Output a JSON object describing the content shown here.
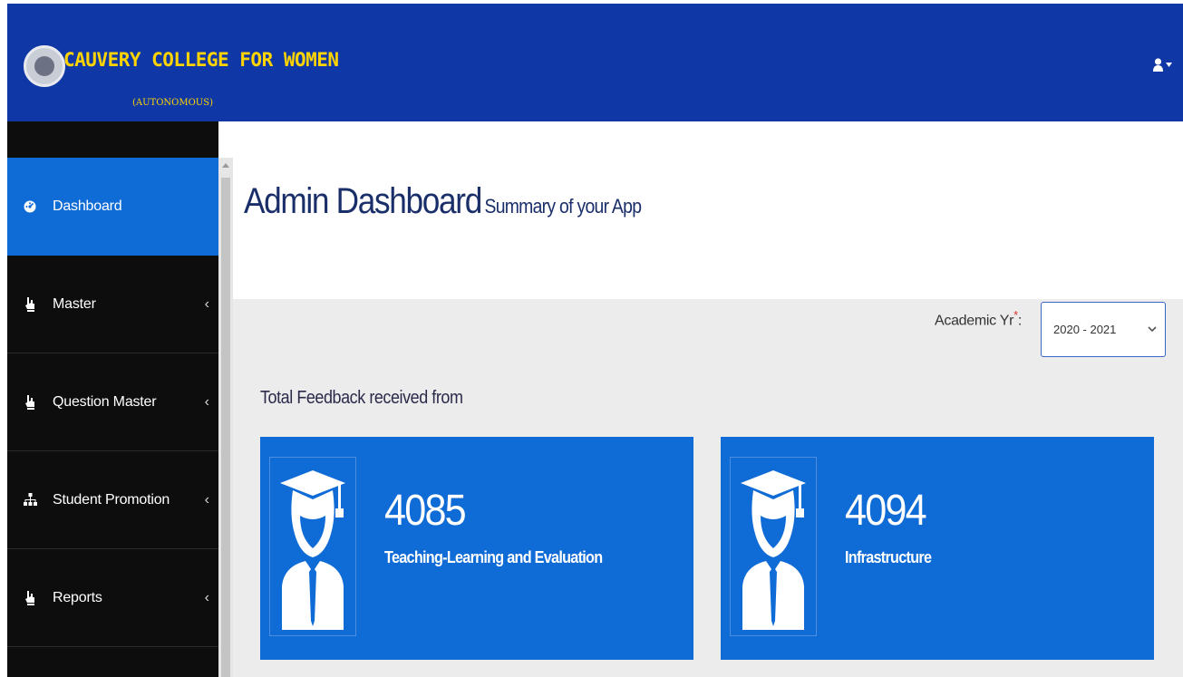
{
  "header": {
    "brand_title": "CAUVERY COLLEGE FOR WOMEN",
    "brand_subtitle": "(AUTONOMOUS)",
    "user_menu_icon": "user-icon",
    "colors": {
      "bar": "#0f38a6",
      "brand_text": "#ffd400"
    }
  },
  "sidebar": {
    "items": [
      {
        "label": "Dashboard",
        "icon": "dashboard-icon",
        "active": true
      },
      {
        "label": "Master",
        "icon": "hand-pointer-icon",
        "chevron": "‹"
      },
      {
        "label": "Question Master",
        "icon": "hand-pointer-icon",
        "chevron": "‹"
      },
      {
        "label": "Student Promotion",
        "icon": "sitemap-icon",
        "chevron": "‹"
      },
      {
        "label": "Reports",
        "icon": "hand-pointer-icon",
        "chevron": "‹"
      }
    ]
  },
  "page": {
    "title": "Admin Dashboard",
    "subtitle": "Summary of your App"
  },
  "filter": {
    "label": "Academic Yr",
    "required_mark": "*",
    "separator": ":",
    "selected": "2020 - 2021"
  },
  "feedback": {
    "heading": "Total Feedback received from",
    "cards": [
      {
        "count": "4085",
        "label": "Teaching-Learning and Evaluation",
        "icon": "graduate-icon"
      },
      {
        "count": "4094",
        "label": "Infrastructure",
        "icon": "graduate-icon"
      }
    ],
    "card_color": "#0f6bd6"
  }
}
